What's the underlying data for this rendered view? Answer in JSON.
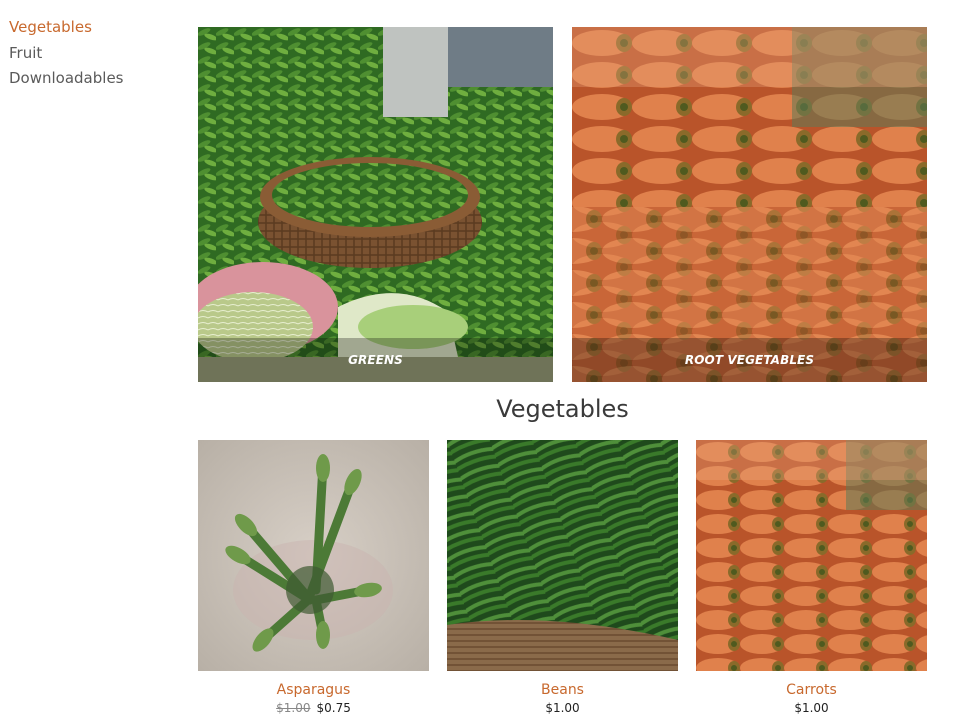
{
  "sidebar": {
    "items": [
      {
        "label": "Vegetables",
        "active": true
      },
      {
        "label": "Fruit",
        "active": false
      },
      {
        "label": "Downloadables",
        "active": false
      }
    ]
  },
  "categories": [
    {
      "label": "GREENS"
    },
    {
      "label": "ROOT VEGETABLES"
    }
  ],
  "section": {
    "title": "Vegetables"
  },
  "products": [
    {
      "name": "Asparagus",
      "old_price": "$1.00",
      "price": "$0.75"
    },
    {
      "name": "Beans",
      "price": "$1.00"
    },
    {
      "name": "Carrots",
      "price": "$1.00"
    }
  ],
  "colors": {
    "accent": "#c8692e",
    "text": "#5a5a5a"
  }
}
